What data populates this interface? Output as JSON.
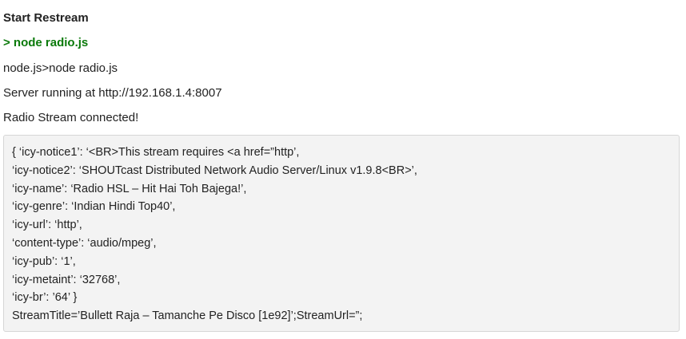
{
  "heading": "Start Restream",
  "command": "> node radio.js",
  "output_lines": [
    "node.js>node radio.js",
    "Server running at http://192.168.1.4:8007",
    "Radio Stream connected!"
  ],
  "code_lines": [
    "{ ‘icy-notice1’: ‘<BR>This stream requires <a href=”http’,",
    "‘icy-notice2’: ‘SHOUTcast Distributed Network Audio Server/Linux v1.9.8<BR>’,",
    "‘icy-name’: ‘Radio HSL – Hit Hai Toh Bajega!’,",
    "‘icy-genre’: ‘Indian Hindi Top40’,",
    "‘icy-url’: ‘http’,",
    "‘content-type’: ‘audio/mpeg’,",
    "‘icy-pub’: ‘1’,",
    "‘icy-metaint’: ‘32768’,",
    "‘icy-br’: ’64’ }",
    "StreamTitle=’Bullett Raja – Tamanche Pe Disco [1e92]’;StreamUrl=”;"
  ]
}
